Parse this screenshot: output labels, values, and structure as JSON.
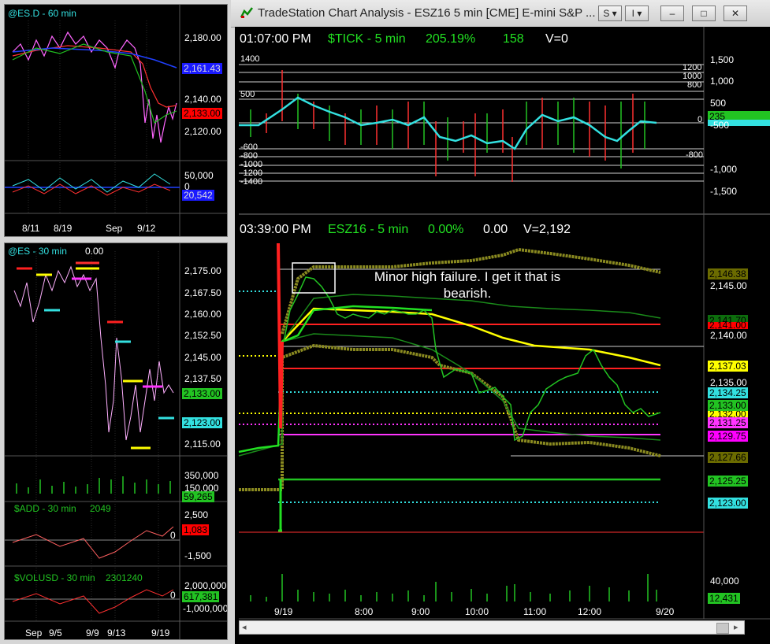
{
  "main_window": {
    "title": "TradeStation Chart Analysis - ESZ16 5 min [CME] E-mini S&P ...",
    "menu_s": "S",
    "menu_i": "I",
    "min": "–",
    "max": "□",
    "close": "✕"
  },
  "tick_panel": {
    "time": "01:07:00 PM",
    "symbol": "$TICK - 5 min",
    "pct": "205.19%",
    "last": "158",
    "vol": "V=0",
    "axis": [
      "1,500",
      "1,000",
      "500",
      "0",
      "-500",
      "-1,000",
      "-1,500"
    ],
    "level_labels_left": [
      "1400",
      "500",
      "-600",
      "-800",
      "-1000",
      "-1200",
      "-1400"
    ],
    "level_labels_right": [
      "1200",
      "1000",
      "800",
      "0",
      "-800"
    ],
    "tags": [
      {
        "text": "235",
        "bg": "#22c322",
        "fg": "#000"
      },
      {
        "text": "",
        "bg": "#33e0e0",
        "fg": "#000"
      }
    ]
  },
  "es_panel": {
    "time": "03:39:00 PM",
    "symbol": "ESZ16 - 5 min",
    "pct": "0.00%",
    "chg": "0.00",
    "vol": "V=2,192",
    "annotation": "Minor high failure.  I get it that is bearish.",
    "axis": [
      "2,145.00",
      "2,140.00",
      "2,135.00"
    ],
    "tags": [
      {
        "text": "2,146.38",
        "bg": "#6b6b00",
        "fg": "#000"
      },
      {
        "text": "2,141.70",
        "bg": "#0d6d0d",
        "fg": "#000"
      },
      {
        "text": "2,141.00",
        "bg": "#ff0000",
        "fg": "#000"
      },
      {
        "text": "2,137.03",
        "bg": "#ffff00",
        "fg": "#000"
      },
      {
        "text": "2,134.25",
        "bg": "#33e0e0",
        "fg": "#000"
      },
      {
        "text": "2,133.00",
        "bg": "#22c322",
        "fg": "#000"
      },
      {
        "text": "2,132.00",
        "bg": "#ffff00",
        "fg": "#000"
      },
      {
        "text": "2,131.25",
        "bg": "#ff33ff",
        "fg": "#000"
      },
      {
        "text": "2,129.75",
        "bg": "#ff00ff",
        "fg": "#000"
      },
      {
        "text": "2,127.66",
        "bg": "#6b6b00",
        "fg": "#000"
      },
      {
        "text": "2,125.25",
        "bg": "#22c322",
        "fg": "#000"
      },
      {
        "text": "2,123.00",
        "bg": "#33e0e0",
        "fg": "#000"
      }
    ],
    "vol_axis": "40,000",
    "vol_tag": "12,431",
    "x_labels": [
      "9/19",
      "8:00",
      "9:00",
      "10:00",
      "11:00",
      "12:00",
      "9/20"
    ]
  },
  "es_d_window": {
    "symbol": "@ES.D - 60 min",
    "axis": [
      "2,180.00",
      "2,140.00",
      "2,120.00"
    ],
    "tag_blue": "2,161.43",
    "tag_red": "2,133.00",
    "sub_axis": [
      "50,000",
      "0"
    ],
    "sub_tag": "20,542",
    "x_labels": [
      "8/11",
      "8/19",
      "Sep",
      "9/12"
    ]
  },
  "es30_window": {
    "symbol": "@ES - 30 min",
    "val": "0.00",
    "axis": [
      "2,175.00",
      "2,167.50",
      "2,160.00",
      "2,152.50",
      "2,145.00",
      "2,137.50",
      "2,115.00"
    ],
    "tag_green": "2,133.00",
    "tag_cyan": "2,123.00",
    "vol_axis": [
      "350,000",
      "150,000"
    ],
    "vol_tag": "59,265",
    "add_label": "$ADD - 30 min",
    "add_val": "2049",
    "add_axis": [
      "2,500",
      "-1,500"
    ],
    "add_zero": "0",
    "add_tag": "1,083",
    "volusd_label": "$VOLUSD - 30 min",
    "volusd_val": "2301240",
    "volusd_axis": [
      "2,000,000",
      "-1,000,000"
    ],
    "volusd_zero": "0",
    "volusd_tag": "617,381",
    "x_labels": [
      "Sep",
      "9/5",
      "9/9",
      "9/13",
      "9/19"
    ]
  }
}
